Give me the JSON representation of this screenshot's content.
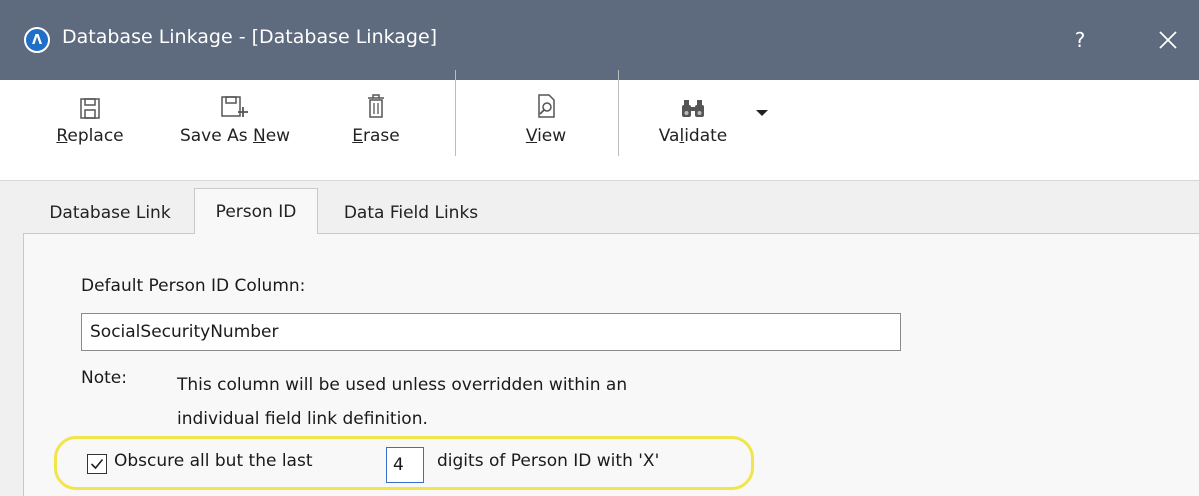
{
  "window": {
    "title": "Database Linkage - [Database Linkage]",
    "app_logo_glyph": "Λ",
    "help_label": "?"
  },
  "toolbar": {
    "buttons": [
      {
        "pre": "",
        "key": "R",
        "post": "eplace",
        "icon": "save-icon"
      },
      {
        "pre": "Save As ",
        "key": "N",
        "post": "ew",
        "icon": "save-as-new-icon"
      },
      {
        "pre": "",
        "key": "E",
        "post": "rase",
        "icon": "trash-icon"
      },
      {
        "pre": "",
        "key": "V",
        "post": "iew",
        "icon": "view-document-icon"
      },
      {
        "pre": "Va",
        "key": "l",
        "post": "idate",
        "icon": "binoculars-icon"
      }
    ]
  },
  "tabs": [
    {
      "label": "Database Link",
      "active": false
    },
    {
      "label": "Person ID",
      "active": true
    },
    {
      "label": "Data Field Links",
      "active": false
    }
  ],
  "person_id": {
    "default_column_label": "Default Person ID Column:",
    "default_column_value": "SocialSecurityNumber",
    "note_label": "Note:",
    "note_line1": "This column will be used unless overridden within an",
    "note_line2": "individual field link definition.",
    "obscure_checked": true,
    "obscure_label": "Obscure all but the last",
    "digits_value": "4",
    "digits_suffix": "digits of Person ID with 'X'"
  },
  "colors": {
    "titlebar": "#5e6a7d",
    "highlight": "#f0e54a",
    "panel": "#f8f8f8"
  }
}
